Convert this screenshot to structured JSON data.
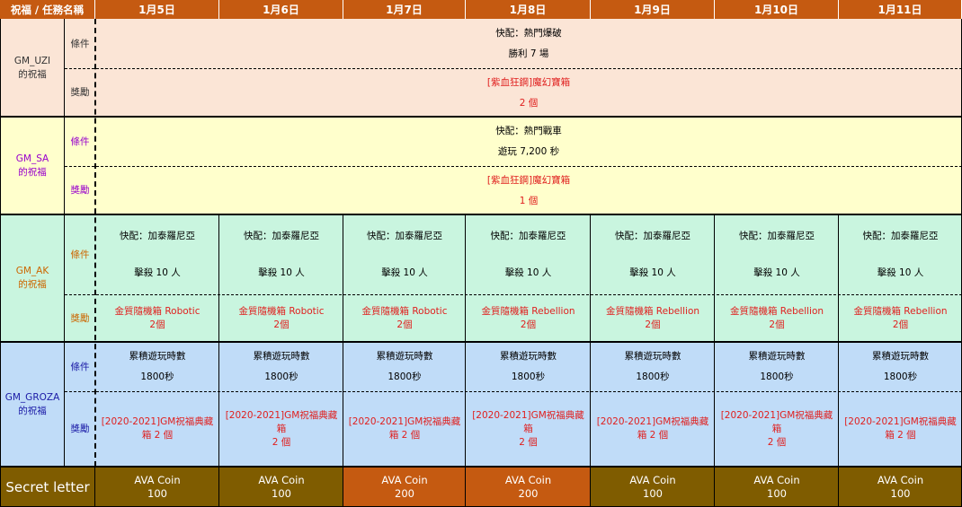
{
  "header": {
    "first_col": "祝福 / 任務名稱",
    "days": [
      "1月5日",
      "1月6日",
      "1月7日",
      "1月8日",
      "1月9日",
      "1月10日",
      "1月11日"
    ]
  },
  "labels": {
    "condition": "條件",
    "reward": "獎勵"
  },
  "colors": {
    "header_bg": "#c55a11",
    "uzi_bg": "#fbe5d6",
    "sa_bg": "#ffffcc",
    "ak_bg": "#c9f5df",
    "groza_bg": "#c0dcf8",
    "uzi_name": "#333333",
    "sa_name": "#9900cc",
    "ak_name": "#cc6600",
    "groza_name": "#1a1aa6",
    "reward_red": "#e0201f",
    "secret_brown": "#7f5c00",
    "secret_orange": "#c55a11"
  },
  "blessings": [
    {
      "name": "GM_UZI\n的祝福",
      "condition": [
        "快配：熱門爆破",
        "勝利 7 場"
      ],
      "reward": [
        "[紫血狂鋼]魔幻寶箱",
        "2 個"
      ]
    },
    {
      "name": "GM_SA\n的祝福",
      "condition": [
        "快配：熱門戰車",
        "遊玩 7,200 秒"
      ],
      "reward": [
        "[紫血狂鋼]魔幻寶箱",
        "1 個"
      ]
    },
    {
      "name": "GM_AK\n的祝福",
      "conditions": [
        [
          "快配：加泰羅尼亞",
          "擊殺 10 人"
        ],
        [
          "快配：加泰羅尼亞",
          "擊殺 10 人"
        ],
        [
          "快配：加泰羅尼亞",
          "擊殺 10 人"
        ],
        [
          "快配：加泰羅尼亞",
          "擊殺 10 人"
        ],
        [
          "快配：加泰羅尼亞",
          "擊殺 10 人"
        ],
        [
          "快配：加泰羅尼亞",
          "擊殺 10 人"
        ],
        [
          "快配：加泰羅尼亞",
          "擊殺 10 人"
        ]
      ],
      "rewards": [
        [
          "金質隨機箱 Robotic",
          "2個"
        ],
        [
          "金質隨機箱 Robotic",
          "2個"
        ],
        [
          "金質隨機箱 Robotic",
          "2個"
        ],
        [
          "金質隨機箱 Rebellion",
          "2個"
        ],
        [
          "金質隨機箱 Rebellion",
          "2個"
        ],
        [
          "金質隨機箱 Rebellion",
          "2個"
        ],
        [
          "金質隨機箱 Rebellion",
          "2個"
        ]
      ]
    },
    {
      "name": "GM_GROZA\n的祝福",
      "conditions": [
        [
          "累積遊玩時數",
          "1800秒"
        ],
        [
          "累積遊玩時數",
          "1800秒"
        ],
        [
          "累積遊玩時數",
          "1800秒"
        ],
        [
          "累積遊玩時數",
          "1800秒"
        ],
        [
          "累積遊玩時數",
          "1800秒"
        ],
        [
          "累積遊玩時數",
          "1800秒"
        ],
        [
          "累積遊玩時數",
          "1800秒"
        ]
      ],
      "rewards": [
        [
          "[2020-2021]GM祝福典藏",
          "箱 2 個"
        ],
        [
          "[2020-2021]GM祝福典藏箱",
          "2 個"
        ],
        [
          "[2020-2021]GM祝福典藏",
          "箱 2 個"
        ],
        [
          "[2020-2021]GM祝福典藏箱",
          "2 個"
        ],
        [
          "[2020-2021]GM祝福典藏",
          "箱 2 個"
        ],
        [
          "[2020-2021]GM祝福典藏箱",
          "2 個"
        ],
        [
          "[2020-2021]GM祝福典藏",
          "箱 2 個"
        ]
      ]
    }
  ],
  "secret": {
    "label": "Secret letter",
    "cells": [
      [
        "AVA Coin",
        "100"
      ],
      [
        "AVA Coin",
        "100"
      ],
      [
        "AVA Coin",
        "200"
      ],
      [
        "AVA Coin",
        "200"
      ],
      [
        "AVA Coin",
        "100"
      ],
      [
        "AVA Coin",
        "100"
      ],
      [
        "AVA Coin",
        "100"
      ]
    ],
    "highlight": [
      false,
      false,
      true,
      true,
      false,
      false,
      false
    ]
  }
}
